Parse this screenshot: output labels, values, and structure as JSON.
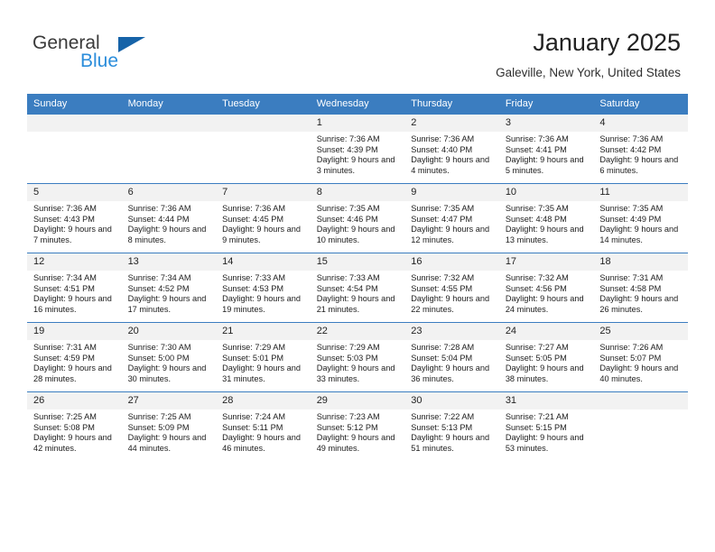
{
  "brand": {
    "name_top": "General",
    "name_bottom": "Blue",
    "triangle_color": "#1663a8",
    "blue_color": "#2b8ddb"
  },
  "header": {
    "month_title": "January 2025",
    "location": "Galeville, New York, United States"
  },
  "theme": {
    "header_bg": "#3b7dc0",
    "daynum_bg": "#f2f2f2",
    "grid_line": "#3b7dc0"
  },
  "calendar": {
    "weekday_headers": [
      "Sunday",
      "Monday",
      "Tuesday",
      "Wednesday",
      "Thursday",
      "Friday",
      "Saturday"
    ],
    "weeks": [
      [
        {
          "day": "",
          "empty": true
        },
        {
          "day": "",
          "empty": true
        },
        {
          "day": "",
          "empty": true
        },
        {
          "day": "1",
          "sunrise": "Sunrise: 7:36 AM",
          "sunset": "Sunset: 4:39 PM",
          "daylight": "Daylight: 9 hours and 3 minutes."
        },
        {
          "day": "2",
          "sunrise": "Sunrise: 7:36 AM",
          "sunset": "Sunset: 4:40 PM",
          "daylight": "Daylight: 9 hours and 4 minutes."
        },
        {
          "day": "3",
          "sunrise": "Sunrise: 7:36 AM",
          "sunset": "Sunset: 4:41 PM",
          "daylight": "Daylight: 9 hours and 5 minutes."
        },
        {
          "day": "4",
          "sunrise": "Sunrise: 7:36 AM",
          "sunset": "Sunset: 4:42 PM",
          "daylight": "Daylight: 9 hours and 6 minutes."
        }
      ],
      [
        {
          "day": "5",
          "sunrise": "Sunrise: 7:36 AM",
          "sunset": "Sunset: 4:43 PM",
          "daylight": "Daylight: 9 hours and 7 minutes."
        },
        {
          "day": "6",
          "sunrise": "Sunrise: 7:36 AM",
          "sunset": "Sunset: 4:44 PM",
          "daylight": "Daylight: 9 hours and 8 minutes."
        },
        {
          "day": "7",
          "sunrise": "Sunrise: 7:36 AM",
          "sunset": "Sunset: 4:45 PM",
          "daylight": "Daylight: 9 hours and 9 minutes."
        },
        {
          "day": "8",
          "sunrise": "Sunrise: 7:35 AM",
          "sunset": "Sunset: 4:46 PM",
          "daylight": "Daylight: 9 hours and 10 minutes."
        },
        {
          "day": "9",
          "sunrise": "Sunrise: 7:35 AM",
          "sunset": "Sunset: 4:47 PM",
          "daylight": "Daylight: 9 hours and 12 minutes."
        },
        {
          "day": "10",
          "sunrise": "Sunrise: 7:35 AM",
          "sunset": "Sunset: 4:48 PM",
          "daylight": "Daylight: 9 hours and 13 minutes."
        },
        {
          "day": "11",
          "sunrise": "Sunrise: 7:35 AM",
          "sunset": "Sunset: 4:49 PM",
          "daylight": "Daylight: 9 hours and 14 minutes."
        }
      ],
      [
        {
          "day": "12",
          "sunrise": "Sunrise: 7:34 AM",
          "sunset": "Sunset: 4:51 PM",
          "daylight": "Daylight: 9 hours and 16 minutes."
        },
        {
          "day": "13",
          "sunrise": "Sunrise: 7:34 AM",
          "sunset": "Sunset: 4:52 PM",
          "daylight": "Daylight: 9 hours and 17 minutes."
        },
        {
          "day": "14",
          "sunrise": "Sunrise: 7:33 AM",
          "sunset": "Sunset: 4:53 PM",
          "daylight": "Daylight: 9 hours and 19 minutes."
        },
        {
          "day": "15",
          "sunrise": "Sunrise: 7:33 AM",
          "sunset": "Sunset: 4:54 PM",
          "daylight": "Daylight: 9 hours and 21 minutes."
        },
        {
          "day": "16",
          "sunrise": "Sunrise: 7:32 AM",
          "sunset": "Sunset: 4:55 PM",
          "daylight": "Daylight: 9 hours and 22 minutes."
        },
        {
          "day": "17",
          "sunrise": "Sunrise: 7:32 AM",
          "sunset": "Sunset: 4:56 PM",
          "daylight": "Daylight: 9 hours and 24 minutes."
        },
        {
          "day": "18",
          "sunrise": "Sunrise: 7:31 AM",
          "sunset": "Sunset: 4:58 PM",
          "daylight": "Daylight: 9 hours and 26 minutes."
        }
      ],
      [
        {
          "day": "19",
          "sunrise": "Sunrise: 7:31 AM",
          "sunset": "Sunset: 4:59 PM",
          "daylight": "Daylight: 9 hours and 28 minutes."
        },
        {
          "day": "20",
          "sunrise": "Sunrise: 7:30 AM",
          "sunset": "Sunset: 5:00 PM",
          "daylight": "Daylight: 9 hours and 30 minutes."
        },
        {
          "day": "21",
          "sunrise": "Sunrise: 7:29 AM",
          "sunset": "Sunset: 5:01 PM",
          "daylight": "Daylight: 9 hours and 31 minutes."
        },
        {
          "day": "22",
          "sunrise": "Sunrise: 7:29 AM",
          "sunset": "Sunset: 5:03 PM",
          "daylight": "Daylight: 9 hours and 33 minutes."
        },
        {
          "day": "23",
          "sunrise": "Sunrise: 7:28 AM",
          "sunset": "Sunset: 5:04 PM",
          "daylight": "Daylight: 9 hours and 36 minutes."
        },
        {
          "day": "24",
          "sunrise": "Sunrise: 7:27 AM",
          "sunset": "Sunset: 5:05 PM",
          "daylight": "Daylight: 9 hours and 38 minutes."
        },
        {
          "day": "25",
          "sunrise": "Sunrise: 7:26 AM",
          "sunset": "Sunset: 5:07 PM",
          "daylight": "Daylight: 9 hours and 40 minutes."
        }
      ],
      [
        {
          "day": "26",
          "sunrise": "Sunrise: 7:25 AM",
          "sunset": "Sunset: 5:08 PM",
          "daylight": "Daylight: 9 hours and 42 minutes."
        },
        {
          "day": "27",
          "sunrise": "Sunrise: 7:25 AM",
          "sunset": "Sunset: 5:09 PM",
          "daylight": "Daylight: 9 hours and 44 minutes."
        },
        {
          "day": "28",
          "sunrise": "Sunrise: 7:24 AM",
          "sunset": "Sunset: 5:11 PM",
          "daylight": "Daylight: 9 hours and 46 minutes."
        },
        {
          "day": "29",
          "sunrise": "Sunrise: 7:23 AM",
          "sunset": "Sunset: 5:12 PM",
          "daylight": "Daylight: 9 hours and 49 minutes."
        },
        {
          "day": "30",
          "sunrise": "Sunrise: 7:22 AM",
          "sunset": "Sunset: 5:13 PM",
          "daylight": "Daylight: 9 hours and 51 minutes."
        },
        {
          "day": "31",
          "sunrise": "Sunrise: 7:21 AM",
          "sunset": "Sunset: 5:15 PM",
          "daylight": "Daylight: 9 hours and 53 minutes."
        },
        {
          "day": "",
          "empty": true
        }
      ]
    ]
  }
}
